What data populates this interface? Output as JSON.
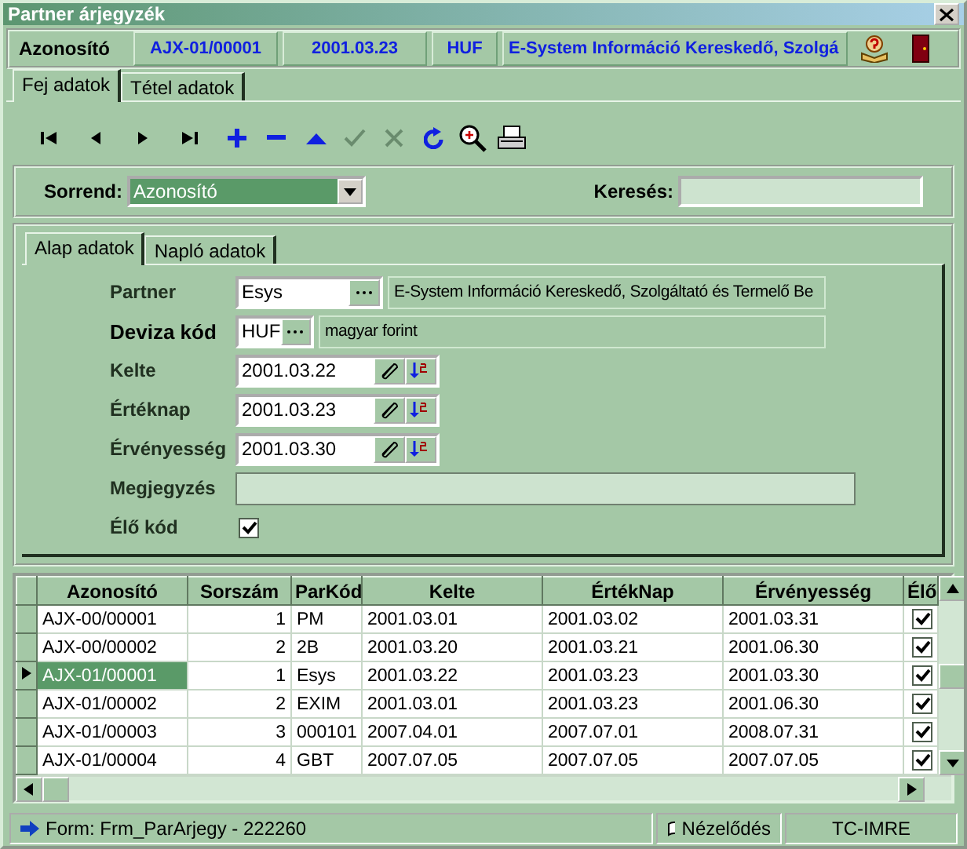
{
  "window": {
    "title": "Partner árjegyzék"
  },
  "header": {
    "label": "Azonosító",
    "fields": [
      "AJX-01/00001",
      "2001.03.23",
      "HUF",
      "E-System Információ Kereskedő, Szolgá"
    ]
  },
  "tabs": [
    {
      "label": "Fej adatok",
      "selected": true
    },
    {
      "label": "Tétel adatok",
      "selected": false
    }
  ],
  "toolbar": [
    {
      "kind": "first",
      "disabled": false
    },
    {
      "kind": "prev",
      "disabled": false
    },
    {
      "kind": "next",
      "disabled": false
    },
    {
      "kind": "last",
      "disabled": false
    },
    {
      "kind": "add",
      "disabled": false
    },
    {
      "kind": "remove",
      "disabled": false
    },
    {
      "kind": "up",
      "disabled": false
    },
    {
      "kind": "confirm",
      "disabled": true
    },
    {
      "kind": "cancel",
      "disabled": true
    },
    {
      "kind": "refresh",
      "disabled": false
    },
    {
      "kind": "zoom",
      "disabled": false
    },
    {
      "kind": "print",
      "disabled": false
    }
  ],
  "sort": {
    "label": "Sorrend:",
    "value": "Azonosító"
  },
  "search": {
    "label": "Keresés:"
  },
  "inner_tabs": [
    {
      "label": "Alap adatok",
      "selected": true
    },
    {
      "label": "Napló adatok",
      "selected": false
    }
  ],
  "fields": [
    {
      "kind": "lookup",
      "label": "Partner",
      "required": false,
      "value": "Esys",
      "description": "E-System Információ Kereskedő, Szolgáltató és Termelő Be"
    },
    {
      "kind": "lookup",
      "label": "Deviza kód",
      "required": true,
      "value": "HUF",
      "description": "magyar forint"
    },
    {
      "kind": "date",
      "label": "Kelte",
      "required": false,
      "value": "2001.03.22"
    },
    {
      "kind": "date",
      "label": "Értéknap",
      "required": false,
      "value": "2001.03.23"
    },
    {
      "kind": "date",
      "label": "Érvényesség",
      "required": false,
      "value": "2001.03.30"
    },
    {
      "kind": "text",
      "label": "Megjegyzés",
      "required": false
    },
    {
      "kind": "checkbox",
      "label": "Élő kód",
      "required": false,
      "checked": true
    }
  ],
  "table": {
    "columns": [
      "Azonosító",
      "Sorszám",
      "ParKód",
      "Kelte",
      "ÉrtékNap",
      "Érvényesség",
      "Élő"
    ],
    "rows": [
      {
        "cells": [
          "AJX-00/00001",
          "1",
          "PM",
          "2001.03.01",
          "2001.03.02",
          "2001.03.31"
        ],
        "live": true,
        "selected": false
      },
      {
        "cells": [
          "AJX-00/00002",
          "2",
          "2B",
          "2001.03.20",
          "2001.03.21",
          "2001.06.30"
        ],
        "live": true,
        "selected": false
      },
      {
        "cells": [
          "AJX-01/00001",
          "1",
          "Esys",
          "2001.03.22",
          "2001.03.23",
          "2001.03.30"
        ],
        "live": true,
        "selected": true
      },
      {
        "cells": [
          "AJX-01/00002",
          "2",
          "EXIM",
          "2001.03.01",
          "2001.03.23",
          "2001.06.30"
        ],
        "live": true,
        "selected": false
      },
      {
        "cells": [
          "AJX-01/00003",
          "3",
          "000101",
          "2007.04.01",
          "2007.07.01",
          "2008.07.31"
        ],
        "live": true,
        "selected": false
      },
      {
        "cells": [
          "AJX-01/00004",
          "4",
          "GBT",
          "2007.07.05",
          "2007.07.05",
          "2007.07.05"
        ],
        "live": true,
        "selected": false
      }
    ]
  },
  "status_bar": {
    "form": "Form: Frm_ParArjegy - 222260",
    "mode": "Nézelődés",
    "user": "TC-IMRE"
  }
}
